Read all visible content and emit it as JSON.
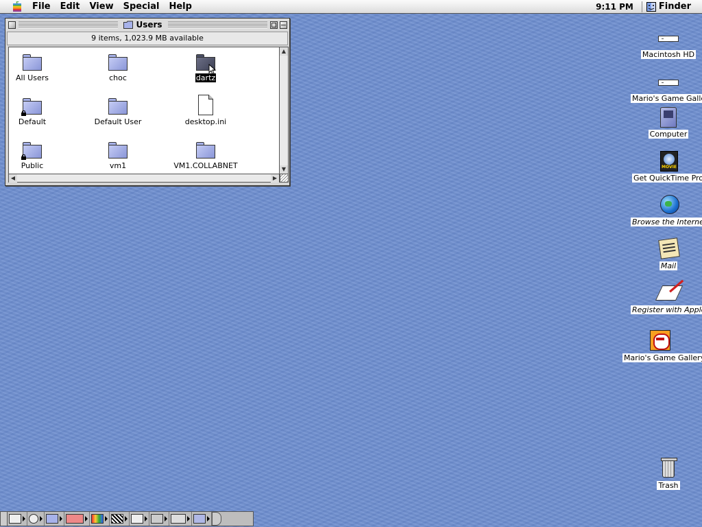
{
  "menubar": {
    "apple_menu": "apple-icon",
    "items": [
      "File",
      "Edit",
      "View",
      "Special",
      "Help"
    ],
    "clock": "9:11 PM",
    "app_name": "Finder"
  },
  "window": {
    "title": "Users",
    "info": "9 items, 1,023.9 MB available",
    "items": [
      {
        "label": "All Users",
        "icon": "folder-icon",
        "locked": false,
        "selected": false
      },
      {
        "label": "choc",
        "icon": "folder-icon",
        "locked": false,
        "selected": false
      },
      {
        "label": "dartz",
        "icon": "folder-icon",
        "locked": false,
        "selected": true
      },
      {
        "label": "Default",
        "icon": "locked-folder-icon",
        "locked": true,
        "selected": false
      },
      {
        "label": "Default User",
        "icon": "folder-icon",
        "locked": false,
        "selected": false
      },
      {
        "label": "desktop.ini",
        "icon": "document-icon",
        "locked": false,
        "selected": false
      },
      {
        "label": "Public",
        "icon": "locked-folder-icon",
        "locked": true,
        "selected": false
      },
      {
        "label": "vm1",
        "icon": "folder-icon",
        "locked": false,
        "selected": false
      },
      {
        "label": "VM1.COLLABNET",
        "icon": "folder-icon",
        "locked": false,
        "selected": false
      }
    ]
  },
  "desktop": {
    "icons": [
      {
        "label": "Macintosh HD",
        "icon": "hard-drive-icon"
      },
      {
        "label": "Mario's Game Gallery",
        "icon": "drive-icon"
      },
      {
        "label": "Computer",
        "icon": "computer-icon"
      },
      {
        "label": "Get QuickTime Pro",
        "icon": "quicktime-icon"
      },
      {
        "label": "Browse the Internet",
        "icon": "globe-icon"
      },
      {
        "label": "Mail",
        "icon": "mail-icon"
      },
      {
        "label": "Register with Apple",
        "icon": "register-icon"
      },
      {
        "label": "Mario's Game Gallery",
        "icon": "mario-icon"
      },
      {
        "label": "Trash",
        "icon": "trash-icon"
      }
    ]
  },
  "control_strip": {
    "modules": [
      "monitor-icon",
      "cd-icon",
      "file-sharing-icon",
      "remote-access-icon",
      "color-depth-icon",
      "resolution-icon",
      "printer-icon",
      "energy-icon",
      "sound-icon",
      "web-sharing-icon"
    ]
  },
  "colors": {
    "desktop": "#6f8fcf",
    "selection": "#000000"
  }
}
